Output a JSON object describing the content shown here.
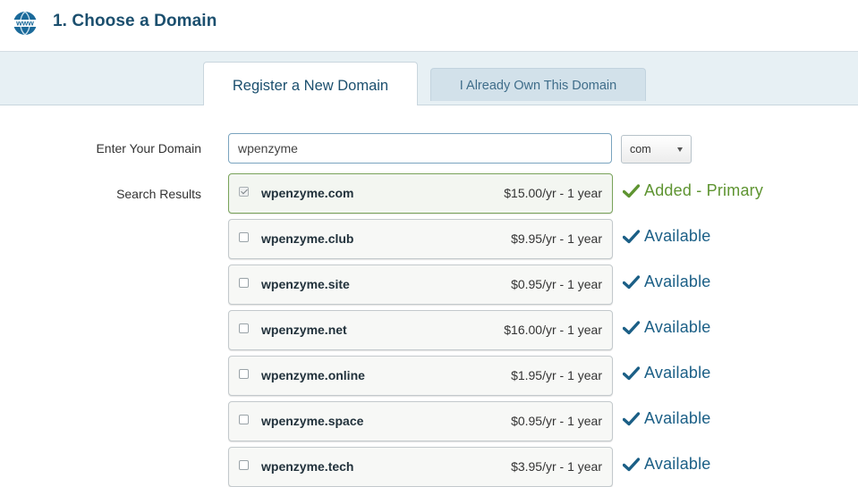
{
  "header": {
    "title": "1. Choose a Domain",
    "icon": "www-globe-icon",
    "icon_text": "www"
  },
  "tabs": [
    {
      "label": "Register a New Domain",
      "active": true
    },
    {
      "label": "I Already Own This Domain",
      "active": false
    }
  ],
  "form": {
    "domain_label": "Enter Your Domain",
    "domain_value": "wpenzyme",
    "tld_selected": "com",
    "results_label": "Search Results"
  },
  "results": [
    {
      "domain": "wpenzyme.com",
      "price": "$15.00/yr - 1 year",
      "status": "Added - Primary",
      "checked": true
    },
    {
      "domain": "wpenzyme.club",
      "price": "$9.95/yr - 1 year",
      "status": "Available",
      "checked": false
    },
    {
      "domain": "wpenzyme.site",
      "price": "$0.95/yr - 1 year",
      "status": "Available",
      "checked": false
    },
    {
      "domain": "wpenzyme.net",
      "price": "$16.00/yr - 1 year",
      "status": "Available",
      "checked": false
    },
    {
      "domain": "wpenzyme.online",
      "price": "$1.95/yr - 1 year",
      "status": "Available",
      "checked": false
    },
    {
      "domain": "wpenzyme.space",
      "price": "$0.95/yr - 1 year",
      "status": "Available",
      "checked": false
    },
    {
      "domain": "wpenzyme.tech",
      "price": "$3.95/yr - 1 year",
      "status": "Available",
      "checked": false
    }
  ],
  "colors": {
    "title": "#1b4f6e",
    "added": "#5e9431",
    "available": "#1b5f86"
  }
}
